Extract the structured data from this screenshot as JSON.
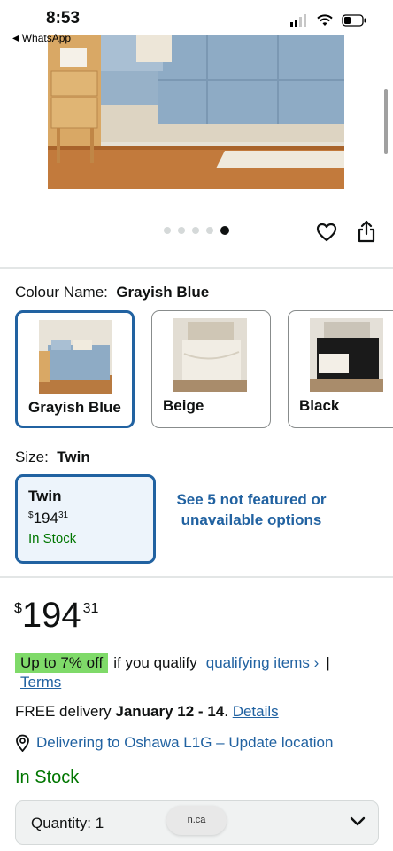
{
  "status_bar": {
    "time": "8:53",
    "back_app": "WhatsApp"
  },
  "gallery": {
    "total_images": 5,
    "active_index": 4
  },
  "colour": {
    "label": "Colour Name:",
    "selected": "Grayish Blue",
    "options": [
      {
        "name": "Grayish Blue"
      },
      {
        "name": "Beige"
      },
      {
        "name": "Black"
      }
    ]
  },
  "size": {
    "label": "Size:",
    "selected": "Twin",
    "option": {
      "name": "Twin",
      "currency": "$",
      "price_whole": "194",
      "price_fraction": "31",
      "stock": "In Stock"
    },
    "more_options": "See 5 not featured or unavailable options"
  },
  "price": {
    "currency": "$",
    "whole": "194",
    "fraction": "31"
  },
  "promo": {
    "badge": "Up to 7% off",
    "qualifier": "if you qualify",
    "link": "qualifying items ›",
    "separator": "|",
    "terms": "Terms"
  },
  "delivery": {
    "prefix": "FREE delivery",
    "date": "January 12 - 14",
    "suffix": ".",
    "details_link": "Details"
  },
  "location": {
    "text": "Delivering to Oshawa L1G – Update location"
  },
  "availability": "In Stock",
  "quantity": {
    "label": "Quantity:",
    "value": "1"
  },
  "url_bar": {
    "text": "n.ca"
  },
  "colors": {
    "link": "#2162a1",
    "selected_border": "#2162a1",
    "in_stock": "#007600",
    "deal_badge": "#7fda69",
    "selected_bg": "#edf4fb"
  },
  "icons": {
    "wishlist": "heart-icon",
    "share": "share-icon",
    "location": "location-pin-icon",
    "dropdown": "chevron-down-icon"
  }
}
